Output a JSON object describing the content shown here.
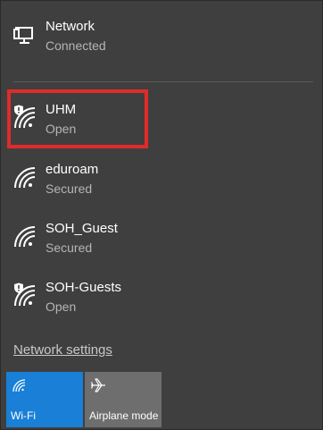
{
  "current_network": {
    "name": "Network",
    "status": "Connected",
    "icon": "ethernet-monitor-icon"
  },
  "networks": [
    {
      "name": "UHM",
      "status": "Open",
      "icon": "wifi-shield-icon",
      "highlighted": true
    },
    {
      "name": "eduroam",
      "status": "Secured",
      "icon": "wifi-icon"
    },
    {
      "name": "SOH_Guest",
      "status": "Secured",
      "icon": "wifi-icon"
    },
    {
      "name": "SOH-Guests",
      "status": "Open",
      "icon": "wifi-shield-icon"
    }
  ],
  "settings_link": "Network settings",
  "quick_actions": [
    {
      "label": "Wi-Fi",
      "icon": "wifi-icon",
      "active": true,
      "color": "#1a7fd6"
    },
    {
      "label": "Airplane mode",
      "icon": "airplane-icon",
      "active": false,
      "color": "#6e6e6e"
    }
  ],
  "highlight_color": "#e12b2b"
}
